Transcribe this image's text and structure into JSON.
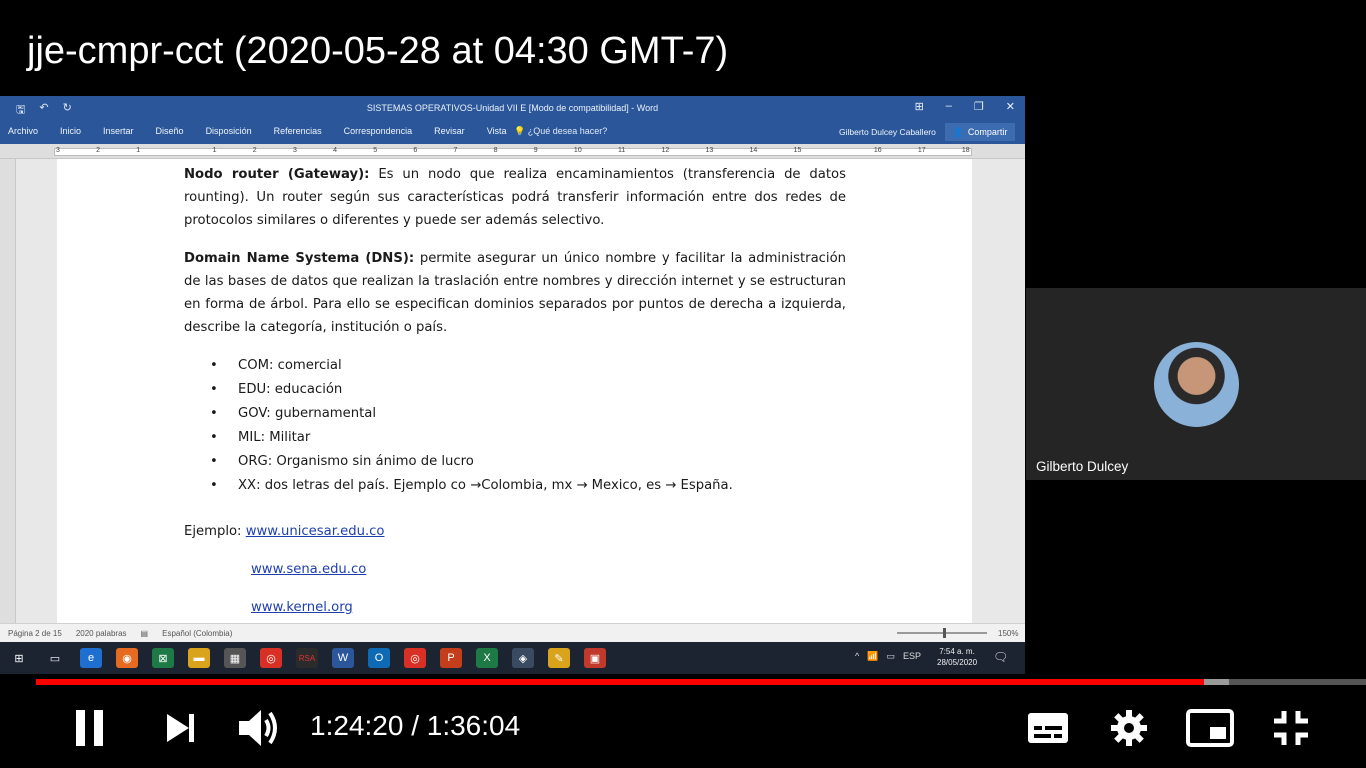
{
  "video_title": "jje-cmpr-cct (2020-05-28 at 04:30 GMT-7)",
  "word": {
    "title": "SISTEMAS OPERATIVOS-Unidad VII E [Modo de compatibilidad] - Word",
    "tabs": [
      "Archivo",
      "Inicio",
      "Insertar",
      "Diseño",
      "Disposición",
      "Referencias",
      "Correspondencia",
      "Revisar",
      "Vista"
    ],
    "help": "¿Qué desea hacer?",
    "user": "Gilberto Dulcey Caballero",
    "share": "Compartir",
    "ruler_nums": [
      "3",
      "2",
      "1",
      "",
      "1",
      "2",
      "3",
      "4",
      "5",
      "6",
      "7",
      "8",
      "9",
      "10",
      "11",
      "12",
      "13",
      "14",
      "15",
      "",
      "16",
      "17",
      "18"
    ]
  },
  "document": {
    "p1_bold": "Nodo router (Gateway):",
    "p1_text": " Es un nodo que realiza encaminamientos (transferencia de datos rounting).  Un router  según sus características podrá transferir información entre dos redes de protocolos similares o diferentes y puede ser además selectivo.",
    "p2_bold": "Domain Name Systema (DNS):",
    "p2_text": " permite asegurar un único nombre y facilitar la administración de las bases  de datos que realizan la traslación entre nombres y dirección internet y se estructuran en forma de árbol. Para ello se especifican dominios separados por puntos de derecha a izquierda, describe la categoría, institución o país.",
    "bullets": [
      "COM: comercial",
      "EDU: educación",
      "GOV: gubernamental",
      "MIL: Militar",
      "ORG: Organismo sin ánimo de lucro",
      "XX: dos letras del país. Ejemplo co →Colombia, mx → Mexico, es → España."
    ],
    "example_label": "Ejemplo: ",
    "links": [
      "www.unicesar.edu.co",
      "www.sena.edu.co",
      "www.kernel.org"
    ]
  },
  "status": {
    "page": "Página 2 de 15",
    "words": "2020 palabras",
    "lang": "Español (Colombia)",
    "zoom": "150%"
  },
  "taskbar": {
    "lang": "ESP",
    "time": "7:54 a. m.",
    "date": "28/05/2020"
  },
  "participant": {
    "name": "Gilberto Dulcey"
  },
  "player": {
    "current_time": "1:24:20",
    "duration": "1:36:04",
    "time_display": "1:24:20 / 1:36:04",
    "progress_fraction": 0.878,
    "buffered_fraction": 0.897
  },
  "colors": {
    "word_blue": "#2b579a",
    "progress_red": "#ff0000"
  }
}
